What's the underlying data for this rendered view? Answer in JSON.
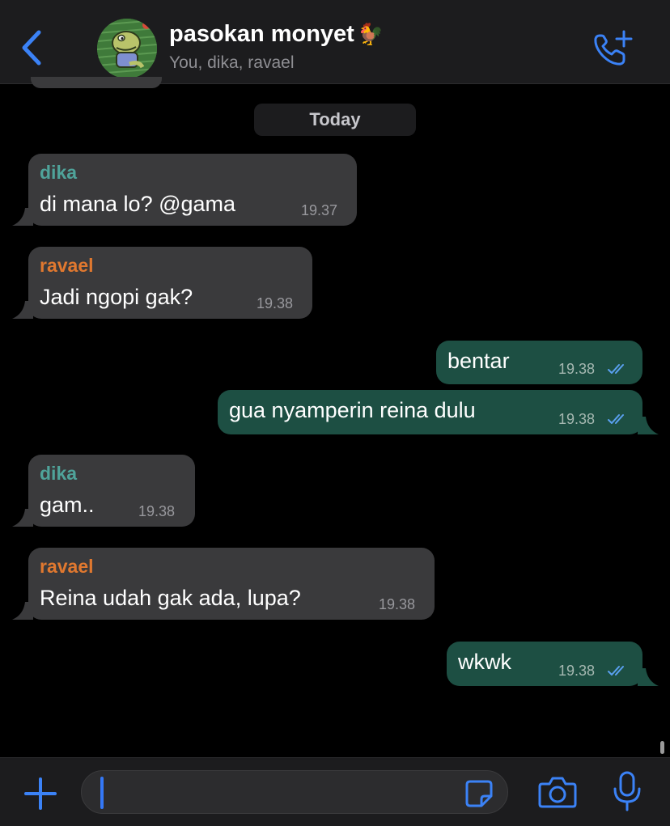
{
  "header": {
    "back_icon": "chevron-left-icon",
    "title": "pasokan monyet",
    "title_emoji": "🐓",
    "subtitle": "You, dika, ravael",
    "call_icon": "phone-plus-icon"
  },
  "date_label": "Today",
  "colors": {
    "accent": "#3b82f6",
    "incoming_bubble": "#3a3a3c",
    "outgoing_bubble": "#1d4f43",
    "sender_dika": "#4fa39a",
    "sender_ravael": "#e0782f",
    "read_ticks": "#5aa0f0"
  },
  "messages": [
    {
      "sender": "dika",
      "text": "di mana lo? @gama",
      "time": "19.37"
    },
    {
      "sender": "ravael",
      "text": "Jadi ngopi gak?",
      "time": "19.38"
    },
    {
      "text": "bentar",
      "time": "19.38"
    },
    {
      "text": "gua nyamperin reina dulu",
      "time": "19.38"
    },
    {
      "sender": "dika",
      "text": "gam..",
      "time": "19.38"
    },
    {
      "sender": "ravael",
      "text": "Reina udah gak ada, lupa?",
      "time": "19.38"
    },
    {
      "text": "wkwk",
      "time": "19.38"
    }
  ],
  "composer": {
    "plus_icon": "plus-icon",
    "input_value": "",
    "sticker_icon": "sticker-icon",
    "camera_icon": "camera-icon",
    "mic_icon": "microphone-icon"
  }
}
